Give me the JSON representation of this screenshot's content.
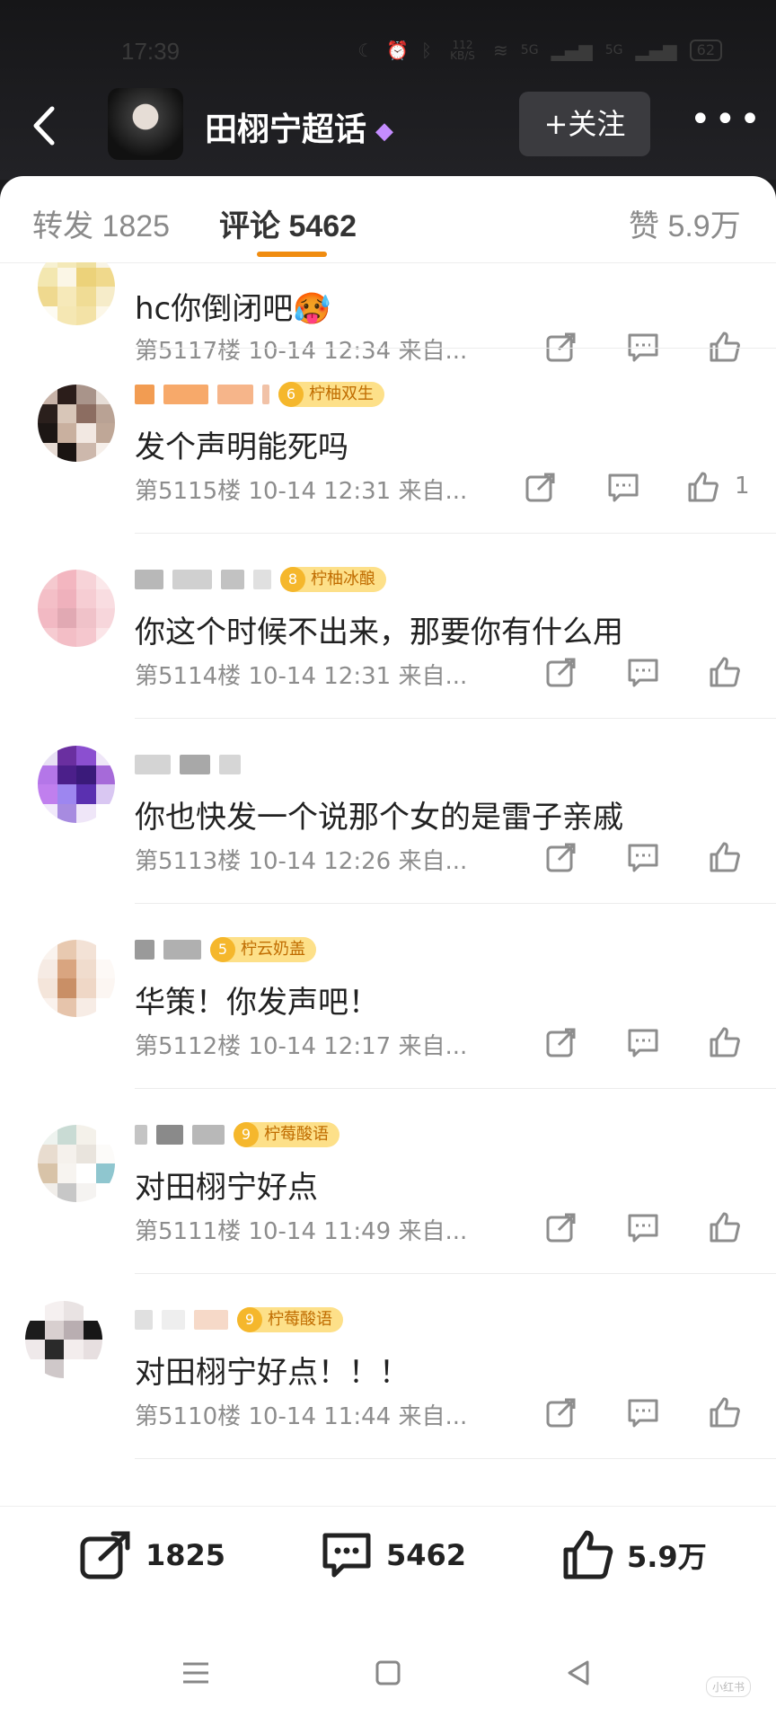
{
  "status_bar": {
    "time": "17:39",
    "net_speed": "112 KB/S",
    "signal1": "5G",
    "signal2": "5G",
    "battery": "62"
  },
  "header": {
    "title": "田栩宁超话",
    "follow_label": "+关注",
    "more_label": "•••"
  },
  "tabs": [
    {
      "label": "转发 1825",
      "active": false
    },
    {
      "label": "评论 5462",
      "active": true
    },
    {
      "label": "赞 5.9万",
      "active": false
    }
  ],
  "comments": [
    {
      "text": "hc你倒闭吧🥵",
      "badge_level": "",
      "badge_text": "",
      "floor": "第5117楼",
      "time": "10-14 12:34",
      "source": "来自...",
      "likes": ""
    },
    {
      "text": "发个声明能死吗",
      "badge_level": "6",
      "badge_text": "柠柚双生",
      "floor": "第5115楼",
      "time": "10-14 12:31",
      "source": "来自...",
      "likes": "1"
    },
    {
      "text": "你这个时候不出来，那要你有什么用",
      "badge_level": "8",
      "badge_text": "柠柚冰酿",
      "floor": "第5114楼",
      "time": "10-14 12:31",
      "source": "来自...",
      "likes": ""
    },
    {
      "text": "你也快发一个说那个女的是雷子亲戚",
      "badge_level": "",
      "badge_text": "",
      "floor": "第5113楼",
      "time": "10-14 12:26",
      "source": "来自...",
      "likes": ""
    },
    {
      "text": "华策！你发声吧！",
      "badge_level": "5",
      "badge_text": "柠云奶盖",
      "floor": "第5112楼",
      "time": "10-14 12:17",
      "source": "来自...",
      "likes": ""
    },
    {
      "text": "对田栩宁好点",
      "badge_level": "9",
      "badge_text": "柠莓酸语",
      "floor": "第5111楼",
      "time": "10-14 11:49",
      "source": "来自...",
      "likes": ""
    },
    {
      "text": "对田栩宁好点！！！",
      "badge_level": "9",
      "badge_text": "柠莓酸语",
      "floor": "第5110楼",
      "time": "10-14 11:44",
      "source": "来自...",
      "likes": ""
    }
  ],
  "bottom_bar": {
    "repost_count": "1825",
    "comment_count": "5462",
    "like_count": "5.9万"
  },
  "watermark": "小红书",
  "colors": {
    "accent": "#f08c10",
    "badge_bg": "#fde089",
    "badge_text": "#c06c00",
    "meta_gray": "#8d8d8d"
  }
}
